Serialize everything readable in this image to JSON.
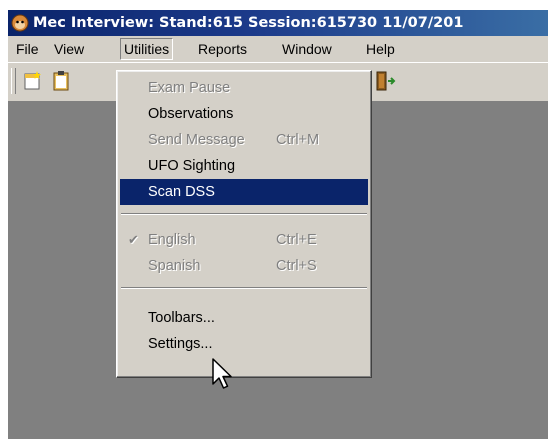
{
  "window": {
    "title": "Mec Interview: Stand:615 Session:615730 11/07/201",
    "colors": {
      "titlebar": "#0a246a",
      "menu_bg": "#d4d0c8",
      "highlight": "#0a246a",
      "client": "#808080"
    }
  },
  "menubar": {
    "items": [
      {
        "label": "File"
      },
      {
        "label": "View"
      },
      {
        "label": "Utilities",
        "active": true
      },
      {
        "label": "Reports"
      },
      {
        "label": "Window"
      },
      {
        "label": "Help"
      }
    ]
  },
  "toolbar": {
    "buttons": [
      {
        "icon": "new-document-icon"
      },
      {
        "icon": "clipboard-icon"
      },
      {
        "icon": "exit-door-icon"
      }
    ]
  },
  "utilities_menu": {
    "items": [
      {
        "label": "Exam Pause",
        "enabled": false
      },
      {
        "label": "Observations",
        "enabled": true
      },
      {
        "label": "Send Message",
        "shortcut": "Ctrl+M",
        "enabled": false
      },
      {
        "label": "UFO Sighting",
        "enabled": true
      },
      {
        "label": "Scan DSS",
        "enabled": true,
        "selected": true
      },
      {
        "label": "English",
        "shortcut": "Ctrl+E",
        "enabled": false,
        "checked": true
      },
      {
        "label": "Spanish",
        "shortcut": "Ctrl+S",
        "enabled": false
      },
      {
        "label": "Toolbars...",
        "enabled": true
      },
      {
        "label": "Settings...",
        "enabled": true
      }
    ]
  }
}
